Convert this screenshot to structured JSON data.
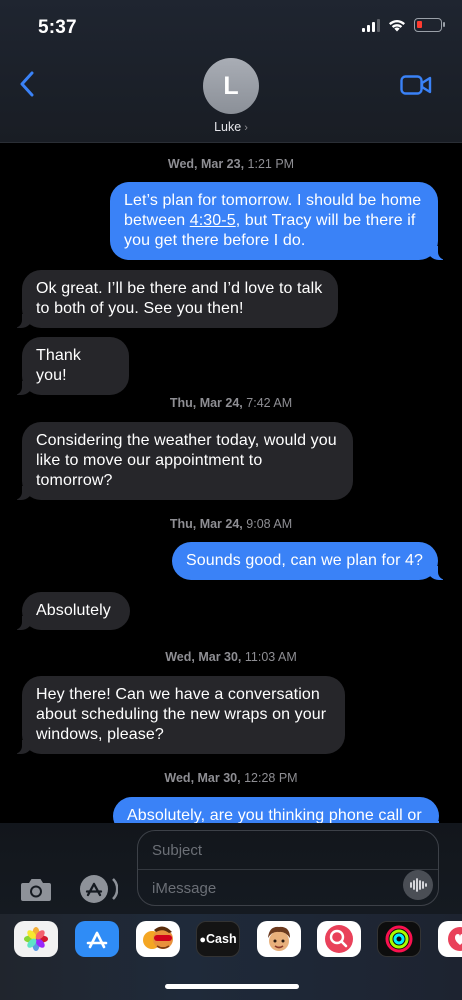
{
  "status_bar": {
    "time": "5:37"
  },
  "contact": {
    "initial": "L",
    "name": "Luke",
    "chevron": "›"
  },
  "messages": [
    {
      "type": "timestamp",
      "day": "Wed, Mar 23,",
      "time": "1:21 PM"
    },
    {
      "type": "outgoing",
      "line1": "Let’s plan for tomorrow. I should be home",
      "line2_pre": "between ",
      "line2_link": "4:30-5",
      "line2_post": ", but Tracy will be there if",
      "line3": "you get there before I do."
    },
    {
      "type": "incoming",
      "text": "Ok great. I’ll be there and I’d love to talk to both of you. See you then!"
    },
    {
      "type": "incoming",
      "text": "Thank you!"
    },
    {
      "type": "timestamp",
      "day": "Thu, Mar 24,",
      "time": "7:42 AM"
    },
    {
      "type": "incoming",
      "text": "Considering the weather today, would you like to move our appointment to tomorrow?"
    },
    {
      "type": "timestamp",
      "day": "Thu, Mar 24,",
      "time": "9:08 AM"
    },
    {
      "type": "outgoing",
      "text": "Sounds good, can we plan for 4?"
    },
    {
      "type": "incoming",
      "text": "Absolutely"
    },
    {
      "type": "timestamp",
      "day": "Wed, Mar 30,",
      "time": "11:03 AM"
    },
    {
      "type": "incoming",
      "text": "Hey there! Can we have a conversation about scheduling the new wraps on your windows, please?"
    },
    {
      "type": "timestamp",
      "day": "Wed, Mar 30,",
      "time": "12:28 PM"
    },
    {
      "type": "outgoing",
      "text": "Absolutely, are you thinking phone call or"
    }
  ],
  "compose": {
    "subject_placeholder": "Subject",
    "message_placeholder": "iMessage"
  },
  "app_drawer": {
    "items": [
      {
        "name": "Photos",
        "icon": "photos-icon"
      },
      {
        "name": "App Store",
        "icon": "app-store-icon"
      },
      {
        "name": "Memoji Stickers",
        "icon": "memoji-stickers-icon"
      },
      {
        "name": "Apple Cash",
        "icon": "apple-cash-icon",
        "label": "Cash"
      },
      {
        "name": "Animoji",
        "icon": "animoji-icon"
      },
      {
        "name": "Images Search",
        "icon": "images-search-icon"
      },
      {
        "name": "Activity",
        "icon": "activity-icon"
      },
      {
        "name": "Digital Touch",
        "icon": "digital-touch-icon"
      }
    ]
  },
  "colors": {
    "outgoing_bubble": "#3a82f7",
    "incoming_bubble": "#26262a",
    "accent": "#3a82f7"
  }
}
